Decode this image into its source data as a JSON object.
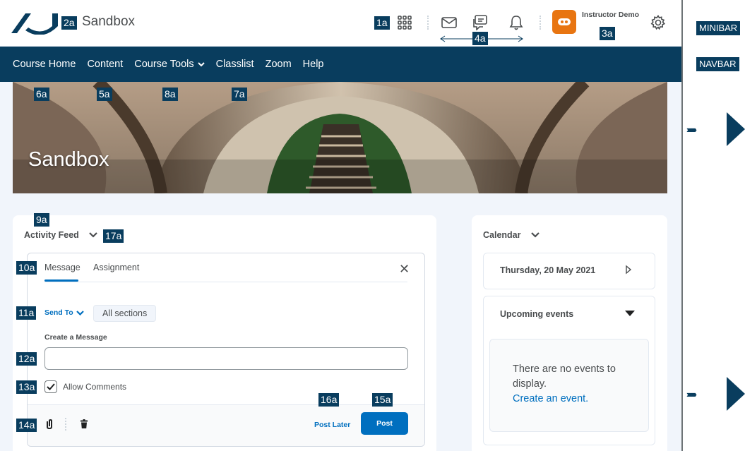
{
  "minibar": {
    "course_title": "Sandbox",
    "user_name": "Instructor Demo",
    "icons": [
      "waffle-icon",
      "mail-icon",
      "chat-icon",
      "bell-icon",
      "gear-icon"
    ]
  },
  "navbar": {
    "items": [
      "Course Home",
      "Content",
      "Course Tools",
      "Classlist",
      "Zoom",
      "Help"
    ]
  },
  "banner": {
    "title": "Sandbox"
  },
  "activity_feed": {
    "heading": "Activity Feed",
    "tabs": [
      "Message",
      "Assignment"
    ],
    "send_to_label": "Send To",
    "send_to_value": "All sections",
    "create_label": "Create a Message",
    "input_value": "",
    "allow_comments_label": "Allow Comments",
    "allow_comments_checked": true,
    "post_later_label": "Post Later",
    "post_label": "Post"
  },
  "calendar": {
    "heading": "Calendar",
    "date": "Thursday, 20 May 2021",
    "upcoming_label": "Upcoming events",
    "empty_text": "There are no events to display.",
    "create_event_link": "Create an event."
  },
  "annotations": {
    "badges": [
      "1a",
      "2a",
      "3a",
      "4a",
      "5a",
      "6a",
      "7a",
      "8a",
      "9a",
      "10a",
      "11a",
      "12a",
      "13a",
      "14a",
      "15a",
      "16a",
      "17a"
    ],
    "side_labels": [
      "MINIBAR",
      "NAVBAR"
    ]
  },
  "colors": {
    "navbar": "#093d5e",
    "accent": "#006fbf",
    "role_avatar": "#e87511"
  }
}
